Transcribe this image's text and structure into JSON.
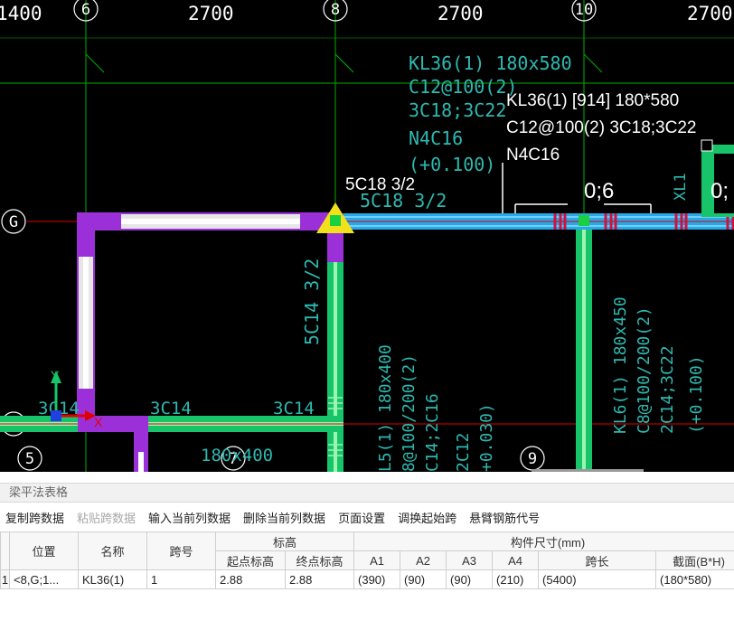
{
  "cad": {
    "top_dims": [
      "1400",
      "2700",
      "2700",
      "2700"
    ],
    "axis_labels": {
      "a6": "6",
      "a8": "8",
      "a10": "10",
      "aG": "G",
      "aF": "F",
      "a5": "5",
      "a7": "7",
      "a9": "9"
    },
    "beam_kl36_cyan": [
      "KL36(1) 180x580",
      "C12@100(2)",
      "3C18;3C22",
      "N4C16",
      "(+0.100)"
    ],
    "beam_kl36_white": [
      "KL36(1) [914] 180*580",
      "C12@100(2) 3C18;3C22",
      "N4C16"
    ],
    "support_label_white": "5C18 3/2",
    "support_label_cyan": "5C18 3/2",
    "span_marker_1": "0;6",
    "span_marker_2": "0;",
    "xl1_label": "XL1",
    "v_beam_label": "5C14 3/2",
    "l5_label": [
      "L5(1) 180x400",
      "8@100/200(2)",
      "C14;2C16",
      "2C12",
      "+0.030)"
    ],
    "kl6_label": [
      "KL6(1) 180x450",
      "C8@100/200(2)",
      "2C14;3C22",
      "(+0.100)"
    ],
    "bottom_left_text": [
      "3C14",
      "3C14",
      "3C14"
    ],
    "dim_1800": "180x400",
    "ucs_x": "X",
    "ucs_y": "Y"
  },
  "panel": {
    "title": "梁平法表格",
    "toolbar": {
      "copy": "复制跨数据",
      "paste": "粘贴跨数据",
      "input_col": "输入当前列数据",
      "delete_col": "删除当前列数据",
      "page_setup": "页面设置",
      "swap_start": "调换起始跨",
      "cantilever": "悬臂钢筋代号"
    },
    "table": {
      "headers": {
        "position": "位置",
        "name": "名称",
        "span_no": "跨号",
        "elevation": "标高",
        "start_elev": "起点标高",
        "end_elev": "终点标高",
        "dims": "构件尺寸(mm)",
        "a1": "A1",
        "a2": "A2",
        "a3": "A3",
        "a4": "A4",
        "span_len": "跨长",
        "section": "截面(B*H)"
      },
      "row": {
        "num": "1",
        "position": "<8,G;1...",
        "name": "KL36(1)",
        "span_no": "1",
        "start_elev": "2.88",
        "end_elev": "2.88",
        "a1": "(390)",
        "a2": "(90)",
        "a3": "(90)",
        "a4": "(210)",
        "span_len": "(5400)",
        "section": "(180*580)"
      }
    }
  },
  "colors": {
    "grid_green": "#00b000",
    "axis_red": "#e00000",
    "beam_cyan": "#2aa8e6",
    "beam_green": "#18c46a",
    "node_magenta": "#9b30d8",
    "text_cyan": "#2fb8b0"
  }
}
